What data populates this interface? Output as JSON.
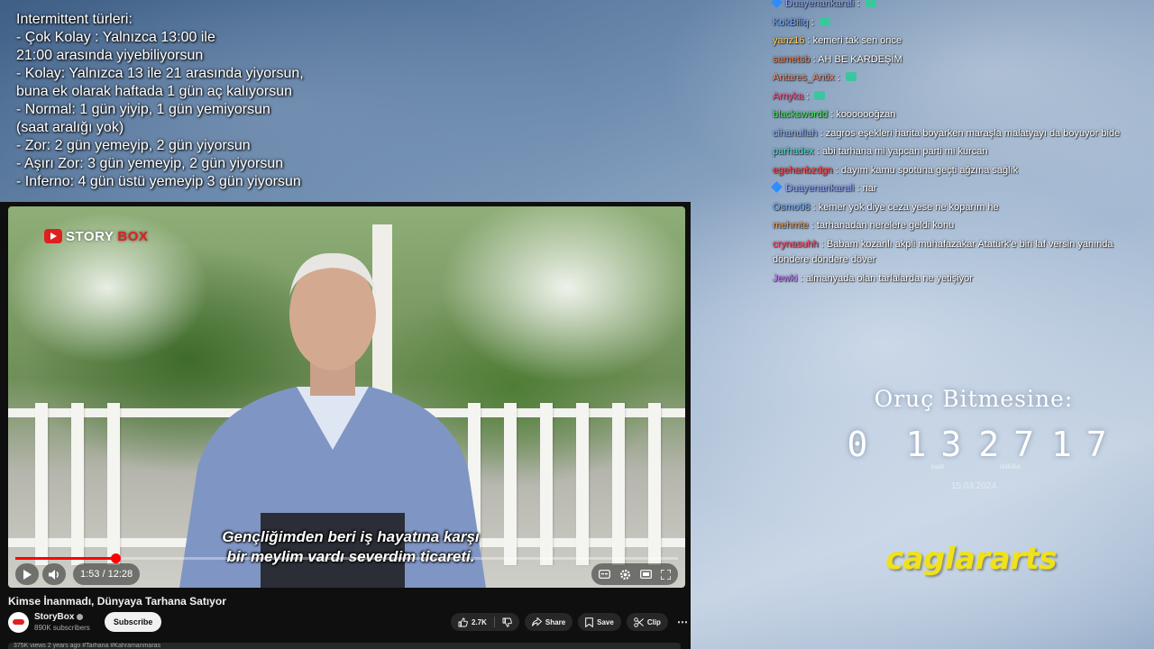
{
  "notes": {
    "heading": "Intermittent türleri:",
    "lines": [
      "- Çok Kolay : Yalnızca 13:00 ile",
      "21:00 arasında yiyebiliyorsun",
      "- Kolay: Yalnızca 13 ile 21 arasında yiyorsun,",
      "buna ek olarak haftada 1 gün aç kalıyorsun",
      "- Normal: 1 gün yiyip, 1 gün yemiyorsun",
      "(saat aralığı yok)",
      "- Zor: 2 gün yemeyip, 2 gün yiyorsun",
      "- Aşırı Zor: 3 gün yemeyip, 2 gün yiyorsun",
      "- Inferno: 4 gün üstü yemeyip 3 gün yiyorsun"
    ]
  },
  "video": {
    "logo_a": "STORY",
    "logo_b": "BOX",
    "subtitle_line1": "Gençliğimden beri iş hayatına karşı",
    "subtitle_line2": "bir meylim vardı severdim ticareti.",
    "time_current": "1:53",
    "time_separator": " / ",
    "time_total": "12:28",
    "progress_fraction": 0.151,
    "title": "Kimse İnanmadı, Dünyaya Tarhana Satıyor",
    "channel_name": "StoryBox",
    "subscribers": "890K subscribers",
    "subscribe_label": "Subscribe",
    "likes": "2.7K",
    "share_label": "Share",
    "save_label": "Save",
    "clip_label": "Clip",
    "more_label": "⋯",
    "description_peek": "375K views  2 years ago  #Tarhana #Kahramanmaras"
  },
  "chat": {
    "messages": [
      {
        "user": "Duayenankarali",
        "text": "",
        "color": "#8fa6ff",
        "badge": true,
        "emote": true
      },
      {
        "user": "KokBiliq",
        "text": "",
        "color": "#6fa8ff",
        "badge": false,
        "emote": true
      },
      {
        "user": "yanz16",
        "text": "kemeri tak sen önce",
        "color": "#ffcf5a",
        "badge": false,
        "emote": false
      },
      {
        "user": "sametsb",
        "text": "AH BE KARDEŞİM",
        "color": "#ff7a3a",
        "badge": false,
        "emote": false
      },
      {
        "user": "Antares_Antix",
        "text": "",
        "color": "#ff8a6a",
        "badge": false,
        "emote": true
      },
      {
        "user": "Arnyka",
        "text": "",
        "color": "#ff5a8a",
        "badge": false,
        "emote": true
      },
      {
        "user": "blackswordd",
        "text": "kooooooğzan",
        "color": "#4fe06a",
        "badge": false,
        "emote": false
      },
      {
        "user": "cihanullah",
        "text": "zagros eşekleri harita boyarken maraşla malatyayı da boyuyor bide",
        "color": "#8fb0ff",
        "badge": false,
        "emote": false
      },
      {
        "user": "parhadex",
        "text": "abi tarhana mi yapcan parti mi kurcan",
        "color": "#4fe0d0",
        "badge": false,
        "emote": false
      },
      {
        "user": "egehanbzdgn",
        "text": "dayım kamu spotuna geçti ağzına sağlık",
        "color": "#ff4a4a",
        "badge": false,
        "emote": false
      },
      {
        "user": "Duayenankarali",
        "text": "nar",
        "color": "#8fa6ff",
        "badge": true,
        "emote": false
      },
      {
        "user": "Osmo08",
        "text": "kemer yok diye ceza yese ne koparım he",
        "color": "#6fb0ff",
        "badge": false,
        "emote": false
      },
      {
        "user": "mehmte",
        "text": "tarhanadan nerelere geldi konu",
        "color": "#ff9a3a",
        "badge": false,
        "emote": false
      },
      {
        "user": "crynasuhh",
        "text": "Babam kozanlı akpli muhafazakar Atatürk'e biri laf versin yanında döndere döndere döver",
        "color": "#ff4a6a",
        "badge": false,
        "emote": false,
        "multi": true
      },
      {
        "user": "Jewki",
        "text": "almanyada olan tarlalarda ne yetişiyor",
        "color": "#c77aff",
        "badge": false,
        "emote": false
      }
    ]
  },
  "timer": {
    "title": "Oruç Bitmesine:",
    "values": [
      {
        "value": "0",
        "label": ""
      },
      {
        "value": "13",
        "label": "saat"
      },
      {
        "value": "27",
        "label": "dakika"
      },
      {
        "value": "17",
        "label": ""
      }
    ],
    "date": "15.03.2024"
  },
  "watermark": "caglararts",
  "icons": {
    "play": "play-icon",
    "volume": "volume-icon",
    "captions": "captions-icon",
    "settings": "gear-icon",
    "miniplayer": "miniplayer-icon",
    "fullscreen": "fullscreen-icon",
    "like": "thumbs-up-icon",
    "dislike": "thumbs-down-icon",
    "share": "share-icon",
    "save": "save-icon",
    "clip": "scissors-icon"
  },
  "colors": {
    "accent": "#ff0000",
    "watermark": "#f0e21a",
    "panel": "#0f0f0f"
  }
}
